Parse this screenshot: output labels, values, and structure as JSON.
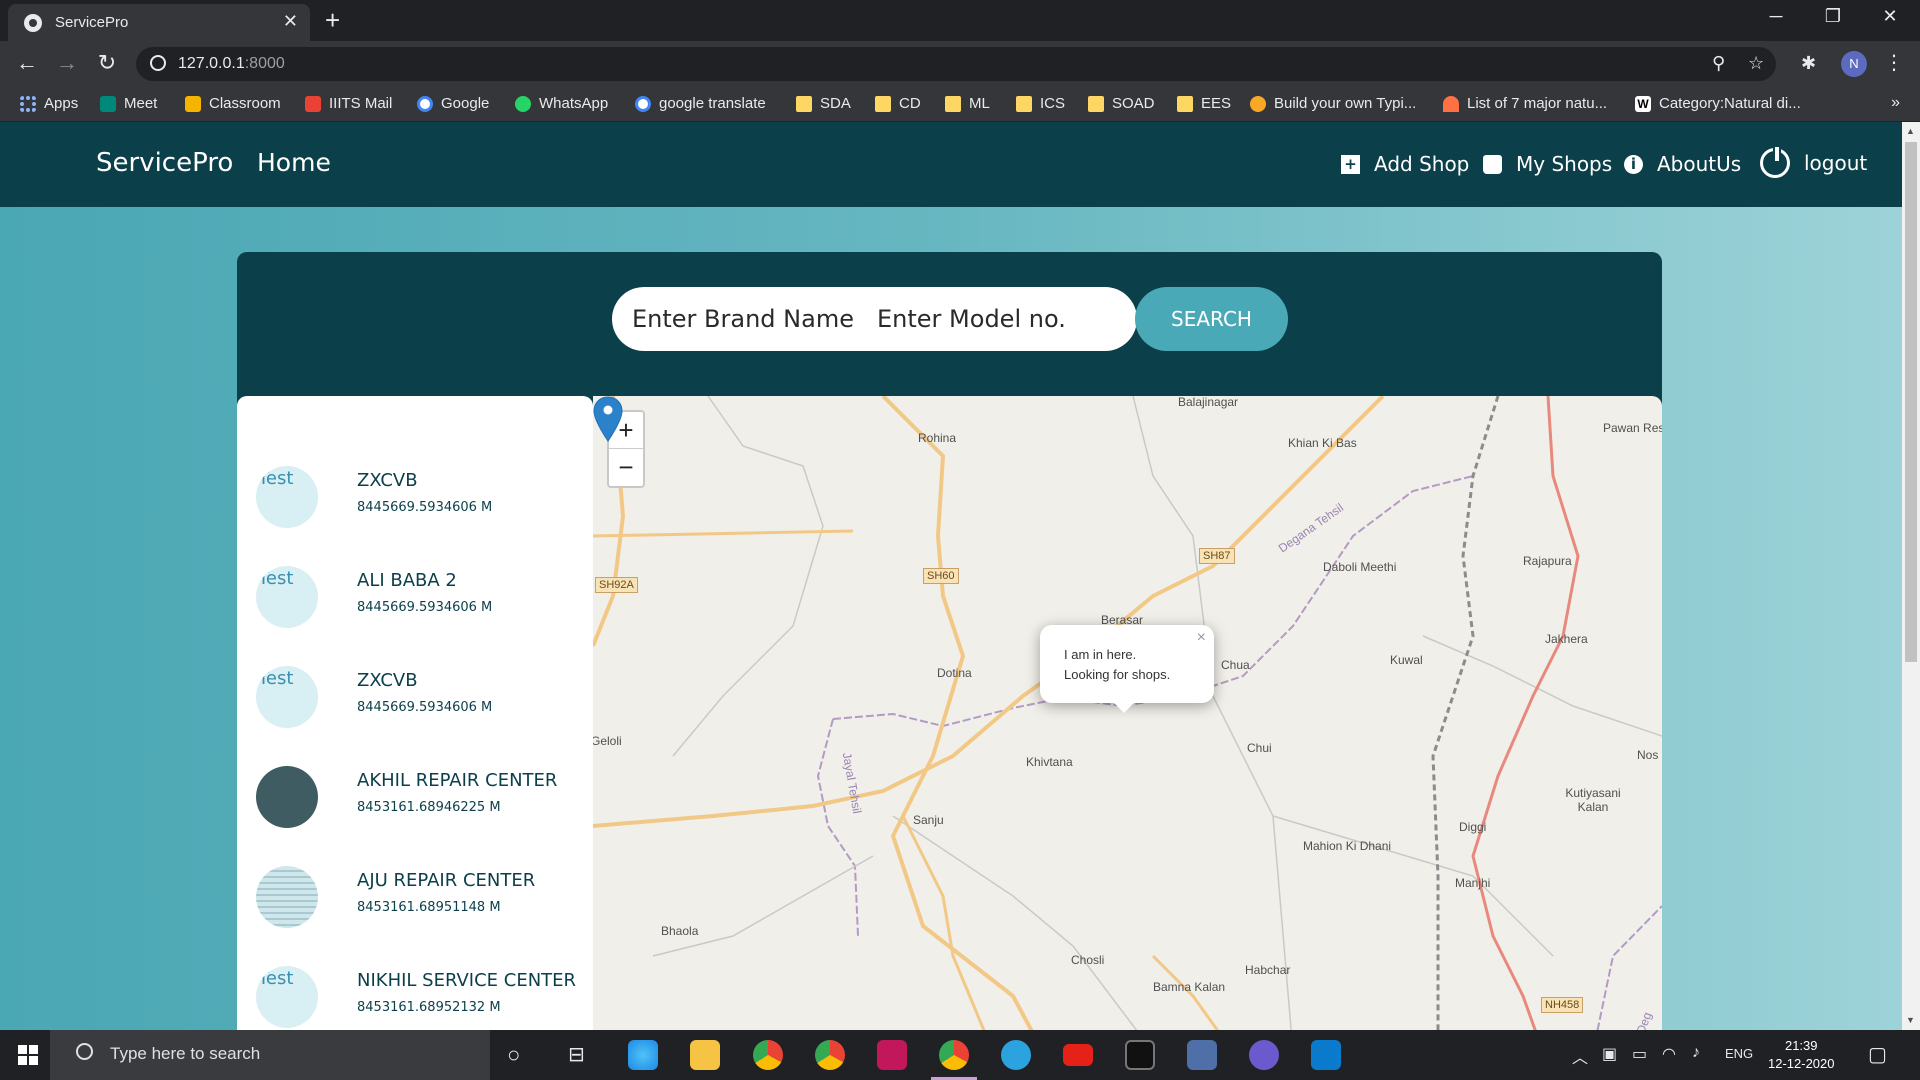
{
  "browser": {
    "tab_title": "ServicePro",
    "tab_close": "✕",
    "new_tab": "+",
    "url_host": "127.0.0.1",
    "url_port": ":8000",
    "profile_initial": "N",
    "bookmarks": [
      "Apps",
      "Meet",
      "Classroom",
      "IIITS Mail",
      "Google",
      "WhatsApp",
      "google translate",
      "SDA",
      "CD",
      "ML",
      "ICS",
      "SOAD",
      "EES",
      "Build your own Typi...",
      "List of 7 major natu...",
      "Category:Natural di..."
    ],
    "bookmarks_more": "»"
  },
  "navbar": {
    "brand": "ServicePro",
    "home": "Home",
    "add_shop": "Add Shop",
    "my_shops": "My Shops",
    "about_us": "AboutUs",
    "logout": "logout"
  },
  "search": {
    "brand_placeholder": "Enter Brand Name",
    "model_placeholder": "Enter Model no.",
    "button": "SEARCH"
  },
  "shops": [
    {
      "name": "ZXCVB",
      "distance": "8445669.5934606 M",
      "avatar_alt": "Test",
      "avatar": "broken"
    },
    {
      "name": "ALI BABA 2",
      "distance": "8445669.5934606 M",
      "avatar_alt": "Test",
      "avatar": "broken"
    },
    {
      "name": "ZXCVB",
      "distance": "8445669.5934606 M",
      "avatar_alt": "Test",
      "avatar": "broken"
    },
    {
      "name": "AKHIL REPAIR CENTER",
      "distance": "8453161.68946225 M",
      "avatar_alt": "",
      "avatar": "dark"
    },
    {
      "name": "AJU REPAIR CENTER",
      "distance": "8453161.68951148 M",
      "avatar_alt": "",
      "avatar": "striped"
    },
    {
      "name": "NIKHIL SERVICE CENTER",
      "distance": "8453161.68952132 M",
      "avatar_alt": "Test",
      "avatar": "broken"
    }
  ],
  "map": {
    "zoom_in": "+",
    "zoom_out": "−",
    "popup_line1": "I am in here.",
    "popup_line2": "Looking for shops.",
    "popup_close": "×",
    "places": [
      "Balajinagar",
      "Khian Ki Bas",
      "Pawan Res",
      "Rohina",
      "Degana Tehsil",
      "Daboli Meethi",
      "Rajapura",
      "Jakhera",
      "Berasar",
      "Chua",
      "Kuwal",
      "Dotina",
      "Geloli",
      "Khivtana",
      "Chui",
      "Jayal Tehsil",
      "Nos",
      "Kutiyasani Kalan",
      "Sanju",
      "Diggi",
      "Mahion Ki Dhani",
      "Manjhi",
      "Bhaola",
      "Chosli",
      "Habchar",
      "Bamna Kalan",
      "Deg"
    ],
    "road_shields": [
      "SH92A",
      "SH60",
      "SH87",
      "NH458"
    ]
  },
  "taskbar": {
    "search_placeholder": "Type here to search",
    "lang": "ENG",
    "time": "21:39",
    "date": "12-12-2020"
  }
}
